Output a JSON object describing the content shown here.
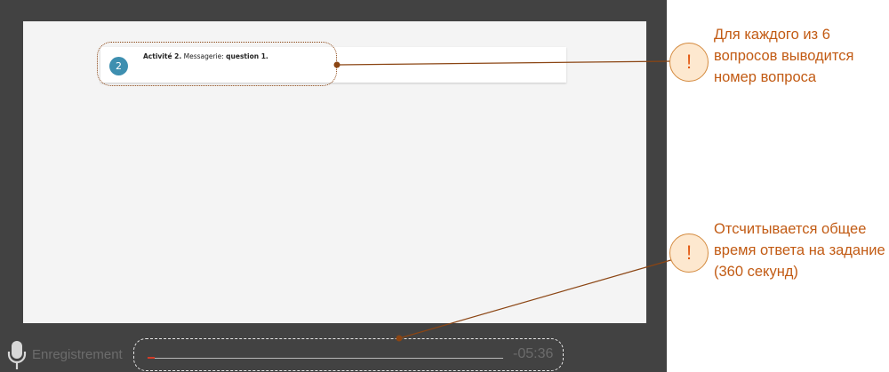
{
  "question": {
    "number": "2",
    "activity": "Activité 2.",
    "module": " Messagerie: ",
    "question_label": "question 1."
  },
  "recorder": {
    "label": "Enregistrement",
    "timer": "-05:36",
    "progress_fraction": 0.02,
    "mic_icon": "microphone-icon"
  },
  "callouts": [
    {
      "badge": "!",
      "text": "Для каждого из 6 вопросов выводится номер вопроса"
    },
    {
      "badge": "!",
      "text": "Отсчитывается общее время ответа на задание (360 секунд)"
    }
  ],
  "colors": {
    "frame": "#424242",
    "badge": "#3e8fb0",
    "callout_text": "#c25b14",
    "progress_marker": "#d23c28"
  }
}
